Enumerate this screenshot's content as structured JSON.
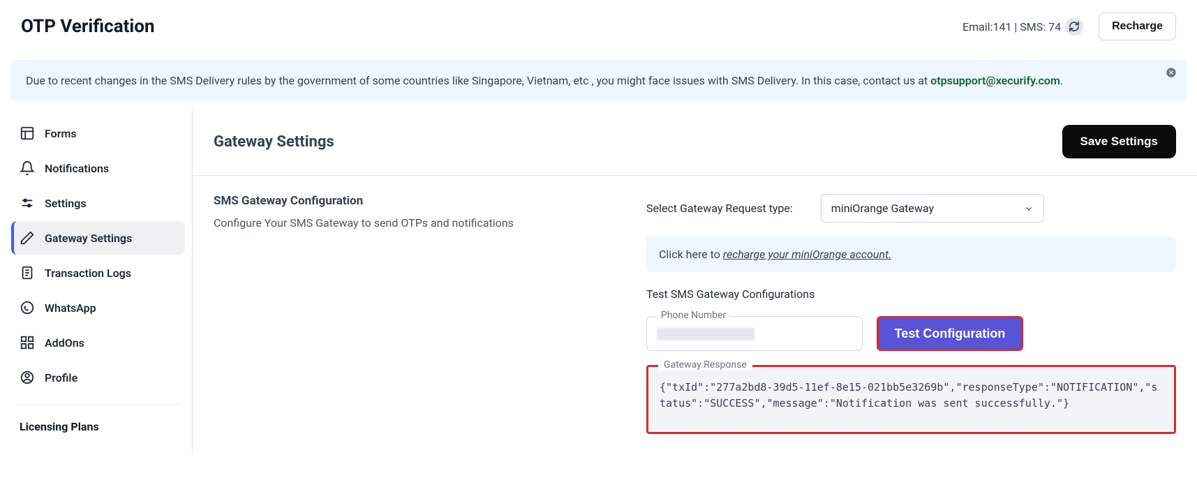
{
  "header": {
    "title": "OTP Verification",
    "stats_email_label": "Email:",
    "stats_email_value": "141",
    "stats_sms_label": "SMS:",
    "stats_sms_value": "74",
    "recharge_label": "Recharge"
  },
  "banner": {
    "text_before": "Due to recent changes in the SMS Delivery rules by the government of some countries like Singapore, Vietnam, etc , you might face issues with SMS Delivery. In this case, contact us at ",
    "email": "otpsupport@xecurify.com",
    "text_after": "."
  },
  "sidebar": {
    "items": [
      {
        "label": "Forms"
      },
      {
        "label": "Notifications"
      },
      {
        "label": "Settings"
      },
      {
        "label": "Gateway Settings"
      },
      {
        "label": "Transaction Logs"
      },
      {
        "label": "WhatsApp"
      },
      {
        "label": "AddOns"
      },
      {
        "label": "Profile"
      }
    ],
    "licensing_label": "Licensing Plans"
  },
  "content": {
    "heading": "Gateway Settings",
    "save_label": "Save Settings",
    "section_title": "SMS Gateway Configuration",
    "section_desc": "Configure Your SMS Gateway to send OTPs and notifications",
    "gateway_type_label": "Select Gateway Request type:",
    "gateway_type_value": "miniOrange Gateway",
    "recharge_note_prefix": "Click here to ",
    "recharge_note_link": "recharge your miniOrange account.",
    "test_title": "Test SMS Gateway Configurations",
    "phone_label": "Phone Number",
    "test_button": "Test Configuration",
    "response_label": "Gateway Response",
    "response_body": "{\"txId\":\"277a2bd8-39d5-11ef-8e15-021bb5e3269b\",\"responseType\":\"NOTIFICATION\",\"status\":\"SUCCESS\",\"message\":\"Notification was sent successfully.\"}"
  }
}
